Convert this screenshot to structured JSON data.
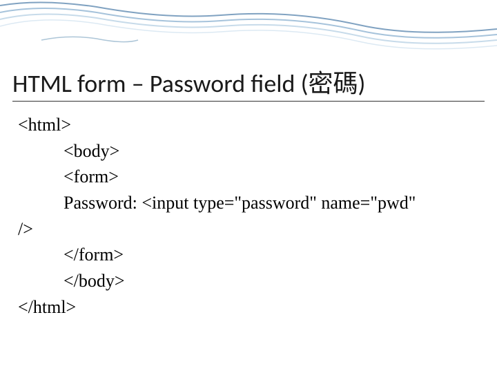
{
  "slide": {
    "title": "HTML form – Password field (密碼)"
  },
  "code": {
    "line1": "<html>",
    "line2": "<body>",
    "line3": "<form>",
    "line4": "Password: <input type=\"password\" name=\"pwd\" ",
    "line5": "/>",
    "line6": "</form>",
    "line7": "</body>",
    "line8": "</html>"
  }
}
